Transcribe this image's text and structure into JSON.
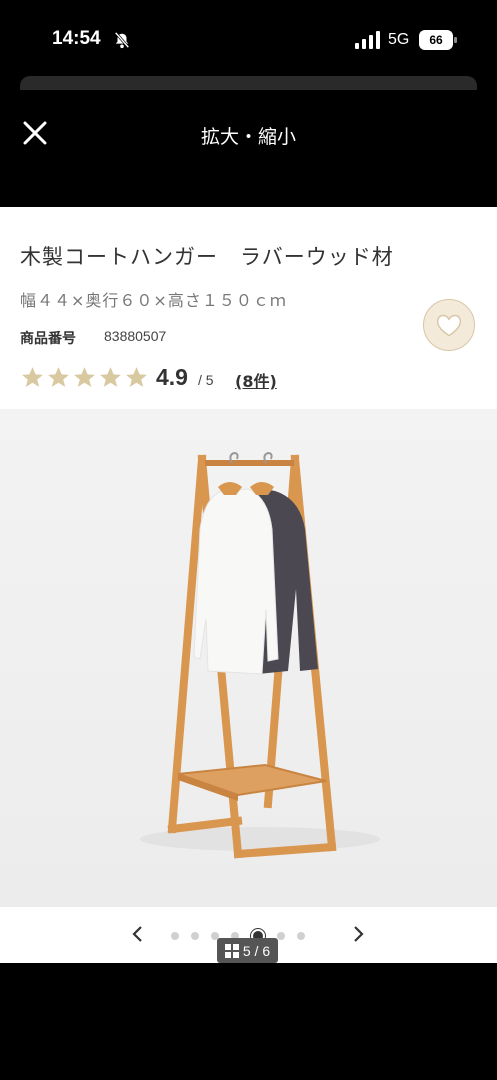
{
  "status_bar": {
    "time": "14:54",
    "network": "5G",
    "battery": "66"
  },
  "header": {
    "title": "拡大・縮小"
  },
  "product": {
    "name": "木製コートハンガー　ラバーウッド材",
    "size": "幅４４×奥行６０×高さ１５０ｃｍ",
    "number_label": "商品番号",
    "number": "83880507",
    "rating": "4.9",
    "rating_max": "/ 5",
    "reviews": "(8件)",
    "stars": 5
  },
  "carousel": {
    "counter": "5 / 6",
    "total_dots": 7,
    "active_dot": 4
  },
  "colors": {
    "star": "#d9c9a0",
    "heart_bg": "#f4ead9",
    "wood": "#d9964f"
  }
}
